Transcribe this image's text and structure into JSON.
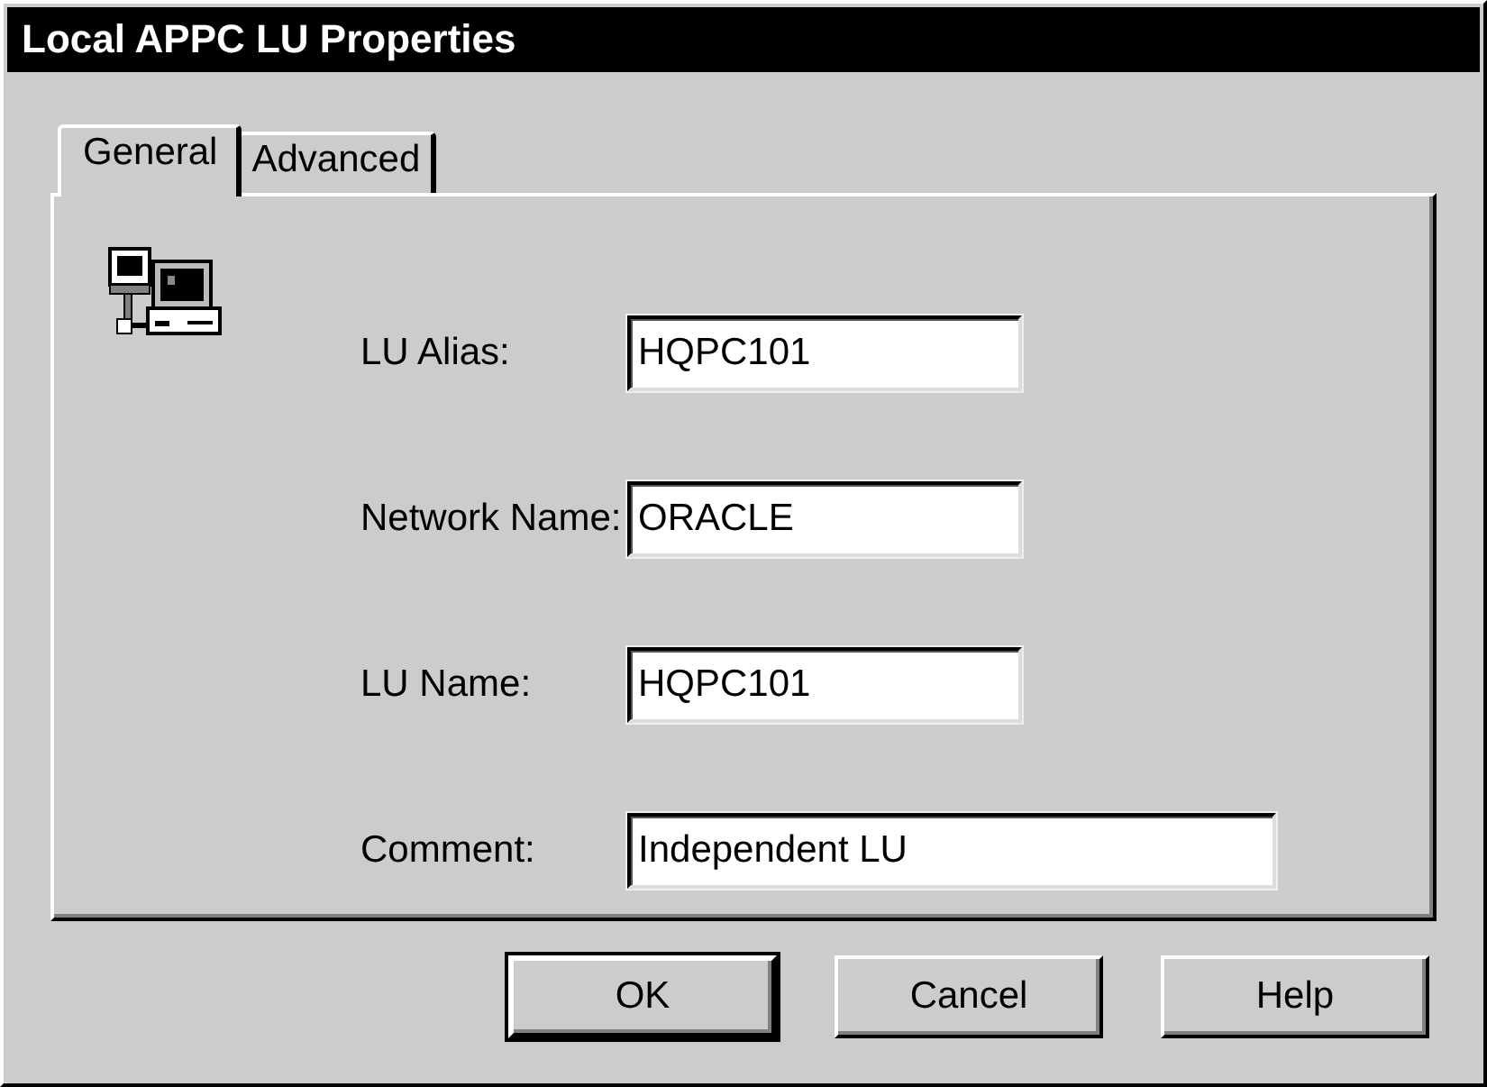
{
  "window": {
    "title": "Local APPC LU Properties"
  },
  "tabs": [
    {
      "label": "General",
      "selected": true
    },
    {
      "label": "Advanced",
      "selected": false
    }
  ],
  "fields": [
    {
      "label": "LU Alias:",
      "value": "HQPC101",
      "wide": false
    },
    {
      "label": "Network Name:",
      "value": "ORACLE",
      "wide": false
    },
    {
      "label": "LU Name:",
      "value": "HQPC101",
      "wide": false
    },
    {
      "label": "Comment:",
      "value": "Independent LU",
      "wide": true
    }
  ],
  "buttons": [
    {
      "label": "OK",
      "default": true
    },
    {
      "label": "Cancel",
      "default": false
    },
    {
      "label": "Help",
      "default": false
    }
  ]
}
